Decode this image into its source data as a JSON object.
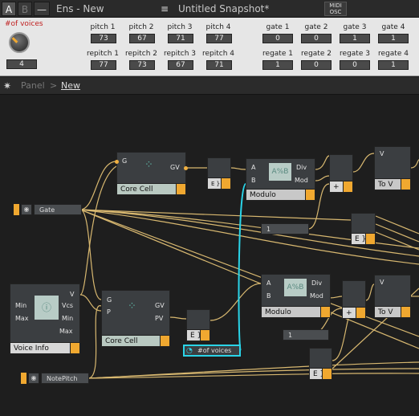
{
  "topbar": {
    "btn_a": "A",
    "btn_b": "B",
    "btn_minus": "—",
    "ensemble_title": "Ens - New",
    "menu_icon": "≡",
    "snapshot_title": "Untitled Snapshot*",
    "midi_label_1": "MIDI",
    "midi_label_2": "OSC"
  },
  "panel": {
    "voices_label": "#of voices",
    "voices_value": "4",
    "pitch": [
      {
        "label": "pitch 1",
        "value": "73"
      },
      {
        "label": "pitch 2",
        "value": "67"
      },
      {
        "label": "pitch 3",
        "value": "71"
      },
      {
        "label": "pitch 4",
        "value": "77"
      }
    ],
    "repitch": [
      {
        "label": "repitch 1",
        "value": "77"
      },
      {
        "label": "repitch 2",
        "value": "73"
      },
      {
        "label": "repitch 3",
        "value": "67"
      },
      {
        "label": "repitch 4",
        "value": "71"
      }
    ],
    "gate": [
      {
        "label": "gate 1",
        "value": "0"
      },
      {
        "label": "gate 2",
        "value": "0"
      },
      {
        "label": "gate 3",
        "value": "1"
      },
      {
        "label": "gate 4",
        "value": "1"
      }
    ],
    "regate": [
      {
        "label": "regate 1",
        "value": "1"
      },
      {
        "label": "regate 2",
        "value": "0"
      },
      {
        "label": "regate 3",
        "value": "0"
      },
      {
        "label": "regate 4",
        "value": "1"
      }
    ]
  },
  "breadcrumb": {
    "root": "Panel",
    "sep": ">",
    "current": "New"
  },
  "canvas": {
    "core_cell_1": {
      "title": "Core Cell",
      "in_g": "G",
      "out_gv": "GV"
    },
    "core_cell_2": {
      "title": "Core Cell",
      "in_g": "G",
      "in_p": "P",
      "out_gv": "GV",
      "out_pv": "PV"
    },
    "ez_1": "E }",
    "ez_2": "E }",
    "ez_3": "E }",
    "ez_4": "E }",
    "modulo_1": {
      "title": "Modulo",
      "in_a": "A",
      "in_b": "B",
      "out_div": "Div",
      "out_mod": "Mod",
      "icon": "A%B"
    },
    "modulo_2": {
      "title": "Modulo",
      "in_a": "A",
      "in_b": "B",
      "out_div": "Div",
      "out_mod": "Mod",
      "icon": "A%B"
    },
    "plus_1": "+",
    "plus_2": "+",
    "tov_1": {
      "title": "To V",
      "in": "V"
    },
    "tov_2": {
      "title": "To V",
      "in": "V"
    },
    "gate": "Gate",
    "notepitch": "NotePitch",
    "const_1": "1",
    "const_2": "1",
    "voices_ctrl": "#of voices",
    "voice_info": {
      "title": "Voice Info",
      "in_min": "Min",
      "in_max": "Max",
      "out_v": "V",
      "out_vcs": "Vcs",
      "out_min": "Min",
      "out_max": "Max"
    }
  },
  "colors": {
    "wire": "#d8b870",
    "wire_selected": "#2ad4e8",
    "accent": "#f0a830",
    "panel_bg": "#e6e6e6",
    "canvas_bg": "#1e1e1e"
  }
}
